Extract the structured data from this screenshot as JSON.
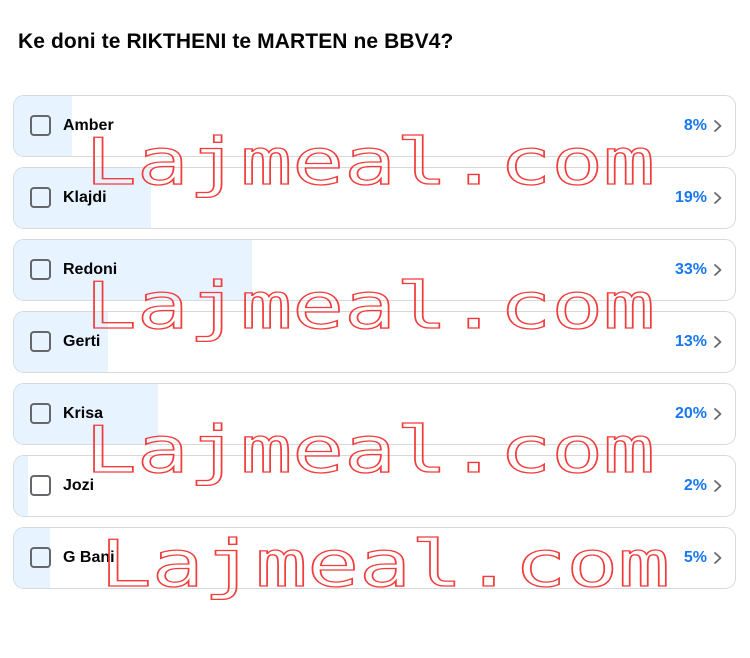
{
  "poll": {
    "question": "Ke doni te RIKTHENI te MARTEN ne BBV4?",
    "options": [
      {
        "label": "Amber",
        "percent_text": "8%",
        "fraction": 0.08
      },
      {
        "label": "Klajdi",
        "percent_text": "19%",
        "fraction": 0.19
      },
      {
        "label": "Redoni",
        "percent_text": "33%",
        "fraction": 0.33
      },
      {
        "label": "Gerti",
        "percent_text": "13%",
        "fraction": 0.13
      },
      {
        "label": "Krisa",
        "percent_text": "20%",
        "fraction": 0.2
      },
      {
        "label": "Jozi",
        "percent_text": "2%",
        "fraction": 0.02
      },
      {
        "label": "G Bani",
        "percent_text": "5%",
        "fraction": 0.05
      }
    ]
  },
  "watermark": {
    "text": "Lajmeal.com",
    "color": "#f23c3c"
  },
  "colors": {
    "fill": "#e7f3ff",
    "percent": "#1877f2",
    "border": "#d6d9dd"
  }
}
